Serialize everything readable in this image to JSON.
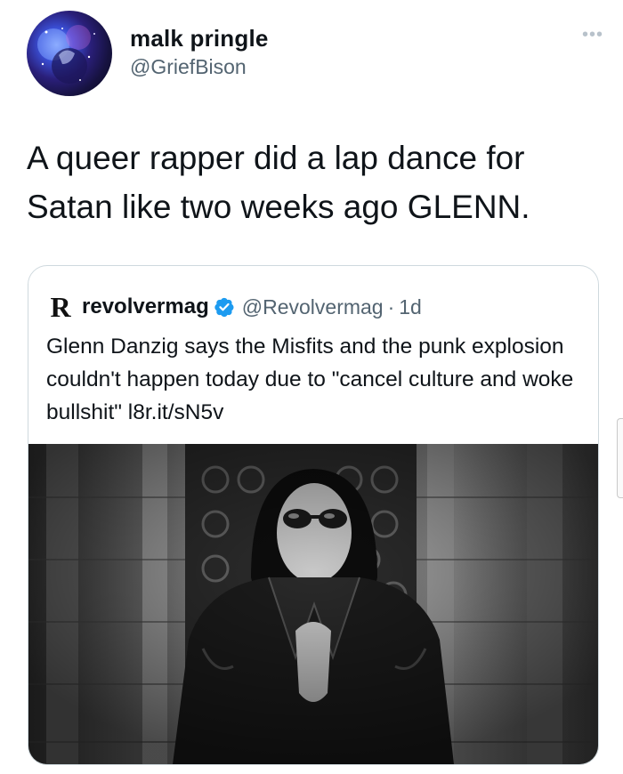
{
  "author": {
    "name": "malk pringle",
    "handle": "@GriefBison"
  },
  "more_label": "•••",
  "tweet_text": "A queer rapper did a lap dance for Satan like two weeks ago GLENN.",
  "quoted": {
    "logo_letter": "R",
    "name": "revolvermag",
    "handle": "@Revolvermag",
    "separator": "·",
    "time": "1d",
    "text": "Glenn Danzig says the Misfits and the punk explosion couldn't happen today due to \"cancel culture and woke bullshit\" l8r.it/sN5v",
    "verified_color": "#1d9bf0"
  },
  "colors": {
    "secondary_text": "#536471",
    "border": "#cfd9de"
  }
}
